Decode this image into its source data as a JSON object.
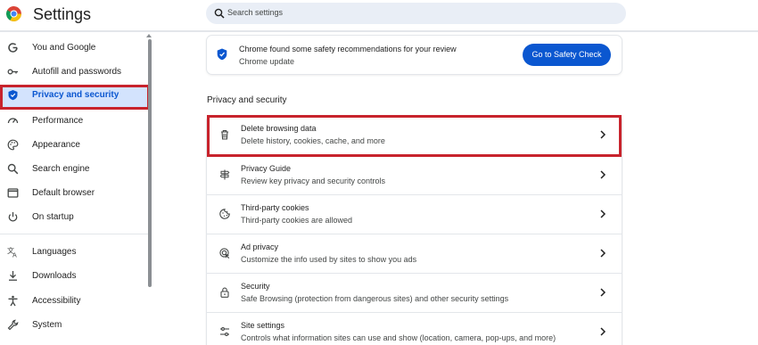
{
  "header": {
    "title": "Settings",
    "search_placeholder": "Search settings"
  },
  "sidebar": {
    "items": [
      {
        "label": "You and Google",
        "icon": "google-g-icon"
      },
      {
        "label": "Autofill and passwords",
        "icon": "key-icon"
      },
      {
        "label": "Privacy and security",
        "icon": "shield-icon",
        "active": true
      },
      {
        "label": "Performance",
        "icon": "speedometer-icon"
      },
      {
        "label": "Appearance",
        "icon": "palette-icon"
      },
      {
        "label": "Search engine",
        "icon": "search-icon"
      },
      {
        "label": "Default browser",
        "icon": "browser-window-icon"
      },
      {
        "label": "On startup",
        "icon": "power-icon"
      },
      {
        "label": "Languages",
        "icon": "translate-icon"
      },
      {
        "label": "Downloads",
        "icon": "download-icon"
      },
      {
        "label": "Accessibility",
        "icon": "accessibility-icon"
      },
      {
        "label": "System",
        "icon": "wrench-icon"
      }
    ]
  },
  "safety_card": {
    "title": "Chrome found some safety recommendations for your review",
    "subtitle": "Chrome update",
    "button": "Go to Safety Check"
  },
  "section": {
    "title": "Privacy and security",
    "rows": [
      {
        "title": "Delete browsing data",
        "subtitle": "Delete history, cookies, cache, and more",
        "icon": "trash-icon"
      },
      {
        "title": "Privacy Guide",
        "subtitle": "Review key privacy and security controls",
        "icon": "signpost-icon"
      },
      {
        "title": "Third-party cookies",
        "subtitle": "Third-party cookies are allowed",
        "icon": "cookie-icon"
      },
      {
        "title": "Ad privacy",
        "subtitle": "Customize the info used by sites to show you ads",
        "icon": "ad-privacy-icon"
      },
      {
        "title": "Security",
        "subtitle": "Safe Browsing (protection from dangerous sites) and other security settings",
        "icon": "lock-icon"
      },
      {
        "title": "Site settings",
        "subtitle": "Controls what information sites can use and show (location, camera, pop-ups, and more)",
        "icon": "sliders-icon"
      }
    ]
  },
  "colors": {
    "accent": "#0b57d0",
    "highlight_border": "#c8232c",
    "active_bg": "#d3e3fd"
  }
}
